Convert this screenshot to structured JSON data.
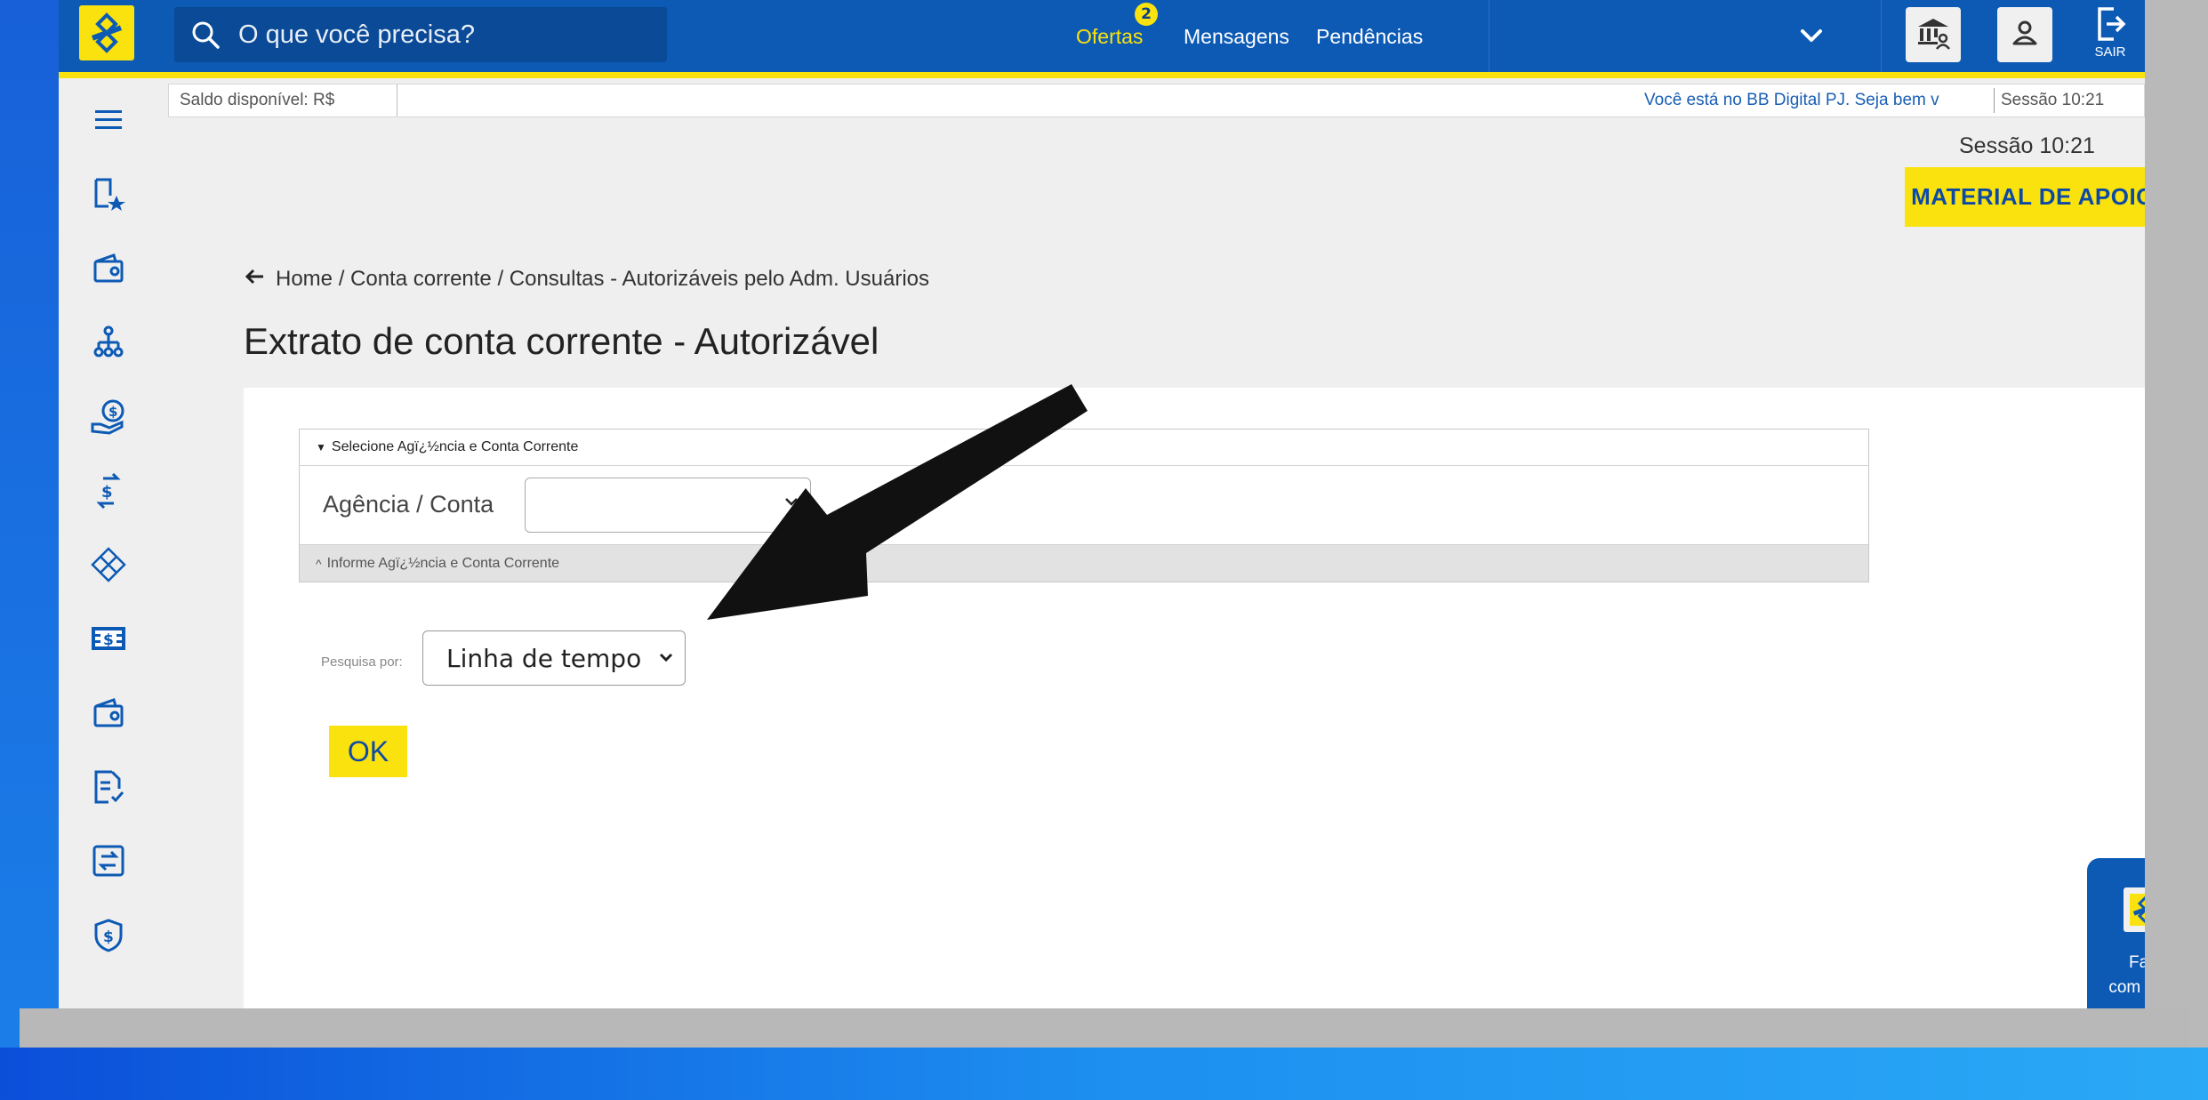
{
  "header": {
    "search_placeholder": "O que você precisa?",
    "nav": {
      "ofertas": "Ofertas",
      "ofertas_badge": "2",
      "mensagens": "Mensagens",
      "pendencias": "Pendências"
    },
    "sair_label": "SAIR"
  },
  "infobar": {
    "saldo": "Saldo disponível:  R$",
    "welcome": "Você está no BB Digital PJ. Seja bem v",
    "sessao": "Sessão 10:21"
  },
  "sessao_big": "Sessão 10:21",
  "material_apoio": "MATERIAL DE APOIO",
  "breadcrumb": "Home / Conta corrente / Consultas - Autorizáveis pelo Adm. Usuários",
  "page_title": "Extrato de conta corrente - Autorizável",
  "accordion": {
    "header": "Selecione Agï¿½ncia e Conta Corrente",
    "label": "Agência / Conta",
    "footer": "Informe Agï¿½ncia e Conta Corrente"
  },
  "search_by": {
    "label": "Pesquisa por:",
    "value": "Linha de tempo"
  },
  "ok_label": "OK",
  "chat": {
    "line1": "Fale",
    "line2": "com o BB"
  },
  "colors": {
    "brand_blue": "#0d5ab5",
    "brand_yellow": "#f9e20e"
  }
}
